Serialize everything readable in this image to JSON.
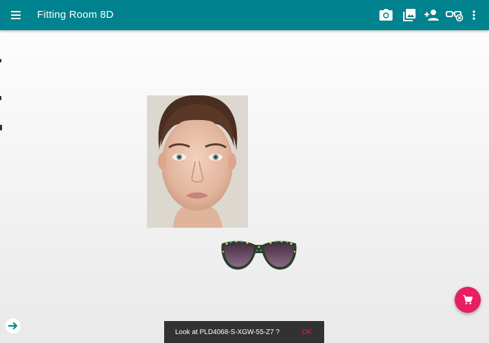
{
  "appbar": {
    "title": "Fitting Room 8D",
    "icons": [
      "menu-icon",
      "camera-icon",
      "gallery-icon",
      "add-person-icon",
      "glasses-remove-icon",
      "more-vert-icon"
    ],
    "color": "#00838f"
  },
  "fab": {
    "icon": "cart-icon",
    "color": "#e91e63"
  },
  "nav": {
    "icon": "arrow-right-icon",
    "color": "#00838f"
  },
  "snackbar": {
    "message": "Look at PLD4068-S-XGW-55-Z7 ?",
    "action": "OK"
  }
}
